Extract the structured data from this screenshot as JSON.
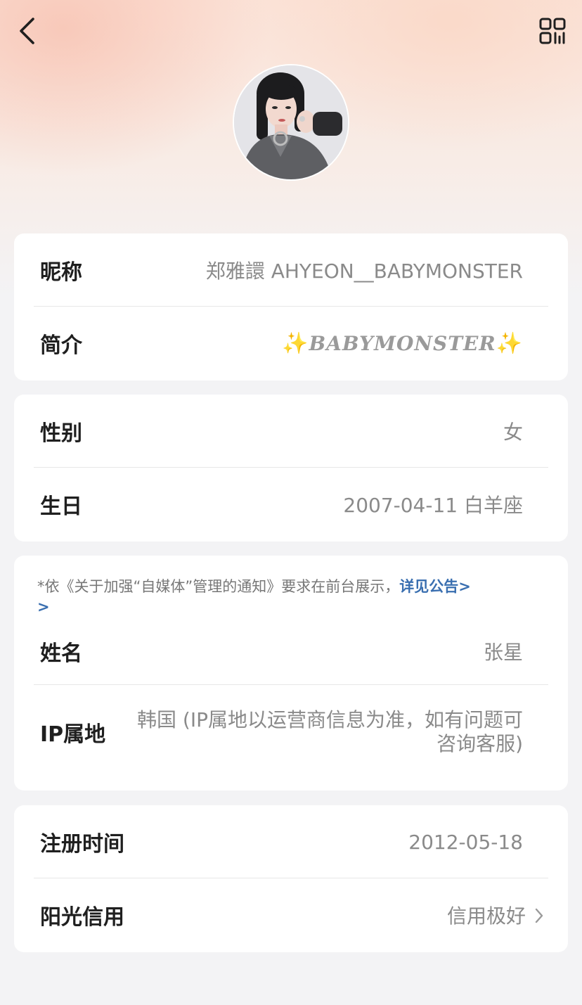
{
  "header": {
    "back_icon": "back-chevron-icon",
    "qr_icon": "qr-code-icon"
  },
  "profile": {
    "nickname_label": "昵称",
    "nickname_value": "郑雅譞 AHYEON__BABYMONSTER",
    "bio_label": "简介",
    "bio_sparkle_left": "✨",
    "bio_text": "BABYMONSTER",
    "bio_sparkle_right": "✨"
  },
  "personal": {
    "gender_label": "性别",
    "gender_value": "女",
    "birthday_label": "生日",
    "birthday_value": "2007-04-11 白羊座"
  },
  "identity": {
    "notice_text": "*依《关于加强“自媒体”管理的通知》要求在前台展示，",
    "notice_link": "详见公告>",
    "notice_tail": ">",
    "name_label": "姓名",
    "name_value": "张星",
    "ip_label": "IP属地",
    "ip_value": "韩国 (IP属地以运营商信息为准，如有问题可咨询客服)"
  },
  "account": {
    "register_label": "注册时间",
    "register_value": "2012-05-18",
    "credit_label": "阳光信用",
    "credit_value": "信用极好",
    "credit_icon": "chevron-right-icon"
  },
  "colors": {
    "accent_link": "#3a6fb0",
    "label_text": "#1f1f1f",
    "value_text": "#8a8a8a",
    "background": "#f3f3f5"
  }
}
